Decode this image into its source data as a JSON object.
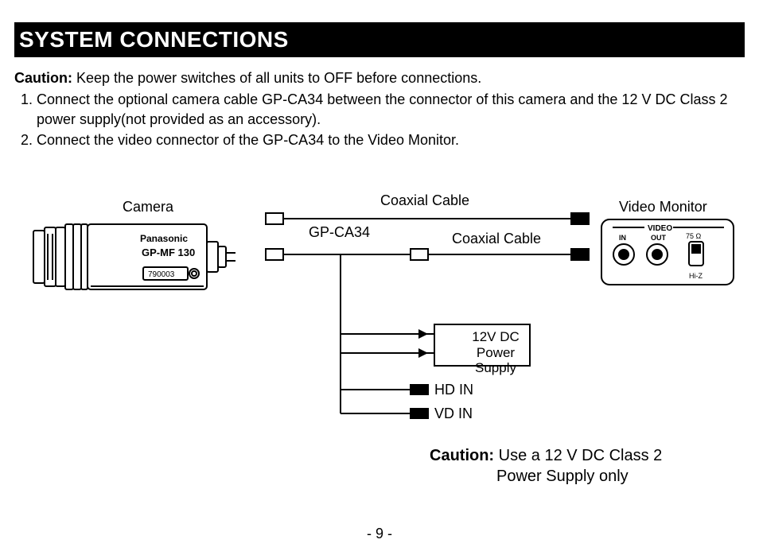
{
  "title": "SYSTEM CONNECTIONS",
  "caution_label": "Caution:",
  "caution_text": " Keep the power switches of all units to OFF before connections.",
  "steps": [
    "Connect the optional camera cable GP-CA34 between the connector of this camera and the 12 V DC Class 2 power supply(not provided as an accessory).",
    "Connect the video connector of the GP-CA34 to the Video Monitor."
  ],
  "labels": {
    "camera": "Camera",
    "coax1": "Coaxial Cable",
    "coax2": "Coaxial Cable",
    "gp_ca34": "GP-CA34",
    "video_monitor": "Video Monitor",
    "video": "VIDEO",
    "in": "IN",
    "out": "OUT",
    "ohm": "75 Ω",
    "hiz": "Hi-Z",
    "psu": "12V DC\nPower Supply",
    "hd_in": "HD IN",
    "vd_in": "VD IN",
    "brand": "Panasonic",
    "model": "GP-MF 130",
    "serial": "790003"
  },
  "caution2_label": "Caution:",
  "caution2_line1": " Use a 12 V DC Class 2",
  "caution2_line2": "Power Supply only",
  "page_number": "- 9 -"
}
